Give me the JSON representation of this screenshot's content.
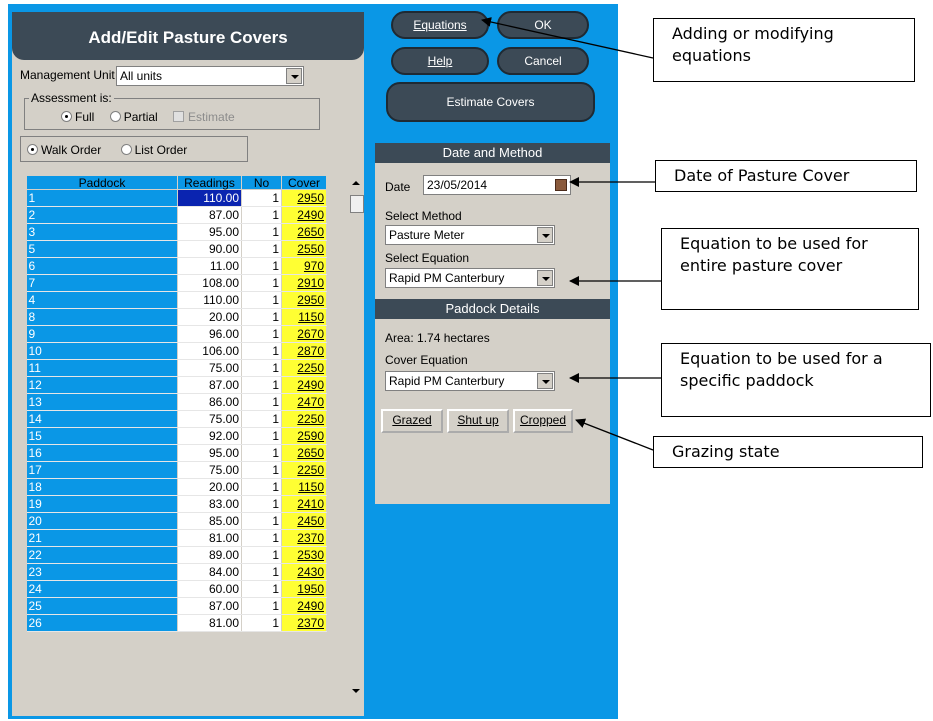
{
  "form": {
    "title": "Add/Edit Pasture Covers",
    "management_unit_label": "Management Unit",
    "management_unit_value": "All units",
    "assessment_label": "Assessment is:",
    "assessment_full": "Full",
    "assessment_partial": "Partial",
    "assessment_estimate": "Estimate",
    "walk_order": "Walk Order",
    "list_order": "List Order"
  },
  "table": {
    "headers": [
      "Paddock",
      "Readings",
      "No",
      "Cover"
    ],
    "rows": [
      [
        "1",
        "110.00",
        "1",
        "2950"
      ],
      [
        "2",
        "87.00",
        "1",
        "2490"
      ],
      [
        "3",
        "95.00",
        "1",
        "2650"
      ],
      [
        "5",
        "90.00",
        "1",
        "2550"
      ],
      [
        "6",
        "11.00",
        "1",
        "970"
      ],
      [
        "7",
        "108.00",
        "1",
        "2910"
      ],
      [
        "4",
        "110.00",
        "1",
        "2950"
      ],
      [
        "8",
        "20.00",
        "1",
        "1150"
      ],
      [
        "9",
        "96.00",
        "1",
        "2670"
      ],
      [
        "10",
        "106.00",
        "1",
        "2870"
      ],
      [
        "11",
        "75.00",
        "1",
        "2250"
      ],
      [
        "12",
        "87.00",
        "1",
        "2490"
      ],
      [
        "13",
        "86.00",
        "1",
        "2470"
      ],
      [
        "14",
        "75.00",
        "1",
        "2250"
      ],
      [
        "15",
        "92.00",
        "1",
        "2590"
      ],
      [
        "16",
        "95.00",
        "1",
        "2650"
      ],
      [
        "17",
        "75.00",
        "1",
        "2250"
      ],
      [
        "18",
        "20.00",
        "1",
        "1150"
      ],
      [
        "19",
        "83.00",
        "1",
        "2410"
      ],
      [
        "20",
        "85.00",
        "1",
        "2450"
      ],
      [
        "21",
        "81.00",
        "1",
        "2370"
      ],
      [
        "22",
        "89.00",
        "1",
        "2530"
      ],
      [
        "23",
        "84.00",
        "1",
        "2430"
      ],
      [
        "24",
        "60.00",
        "1",
        "1950"
      ],
      [
        "25",
        "87.00",
        "1",
        "2490"
      ],
      [
        "26",
        "81.00",
        "1",
        "2370"
      ]
    ]
  },
  "buttons": {
    "equations": "Equations",
    "ok": "OK",
    "help": "Help",
    "cancel": "Cancel",
    "estimate_covers": "Estimate Covers",
    "grazed": "Grazed",
    "shut_up": "Shut up",
    "cropped": "Cropped"
  },
  "date_method": {
    "header": "Date and Method",
    "date_label": "Date",
    "date_value": "23/05/2014",
    "method_label": "Select Method",
    "method_value": "Pasture Meter",
    "equation_label": "Select Equation",
    "equation_value": "Rapid PM Canterbury"
  },
  "paddock_details": {
    "header": "Paddock Details",
    "area": "Area: 1.74 hectares",
    "cover_equation_label": "Cover Equation",
    "cover_equation_value": "Rapid PM Canterbury"
  },
  "callouts": {
    "equations": "Adding or modifying equations",
    "date": "Date of Pasture Cover",
    "equation_entire": "Equation to be used for entire pasture cover",
    "equation_paddock": "Equation to be used for a specific paddock",
    "grazing": "Grazing state"
  },
  "colors": {
    "panel_blue": "#0a97e6",
    "dark_slate": "#3c4a56",
    "cover_yellow": "#ffff33",
    "dialog_grey": "#d4d0c8"
  }
}
